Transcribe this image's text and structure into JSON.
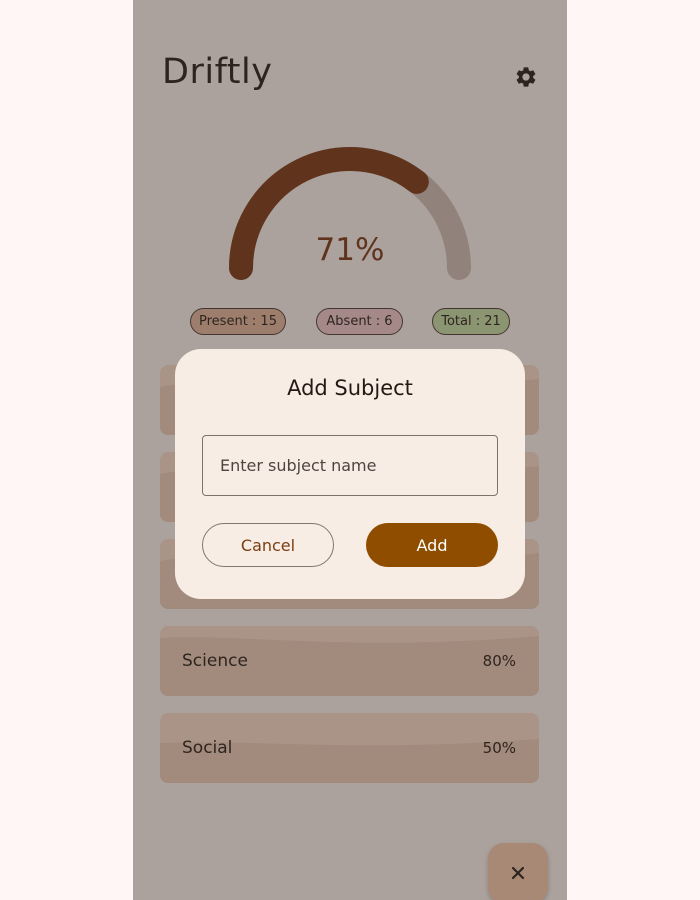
{
  "app": {
    "title": "Driftly"
  },
  "icons": {
    "settings": "gear-icon",
    "close": "close-icon"
  },
  "attendance": {
    "percent": 71,
    "percent_text": "71%",
    "present_label": "Present : 15",
    "absent_label": "Absent : 6",
    "total_label": "Total : 21"
  },
  "subjects": [
    {
      "name": "Science",
      "percent_text": "80%"
    },
    {
      "name": "Social",
      "percent_text": "50%"
    }
  ],
  "dialog": {
    "title": "Add Subject",
    "input_placeholder": "Enter subject name",
    "input_value": "",
    "cancel_label": "Cancel",
    "add_label": "Add"
  },
  "fab": {
    "label": "×"
  },
  "colors": {
    "gauge_progress": "#7a3411",
    "gauge_track": "#cfbdb2",
    "present_chip": "#e3b59a",
    "absent_chip": "#efc9c9",
    "total_chip": "#c4dca0",
    "primary": "#8f4d00",
    "card": "#f8dbc6"
  }
}
